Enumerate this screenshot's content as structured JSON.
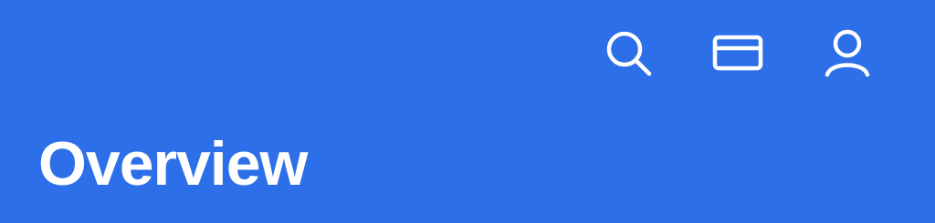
{
  "header": {
    "title": "Overview",
    "background_color": "#2C6FE8",
    "foreground_color": "#FFFFFF",
    "actions": [
      {
        "icon": "search-icon"
      },
      {
        "icon": "credit-card-icon"
      },
      {
        "icon": "user-icon"
      }
    ]
  }
}
